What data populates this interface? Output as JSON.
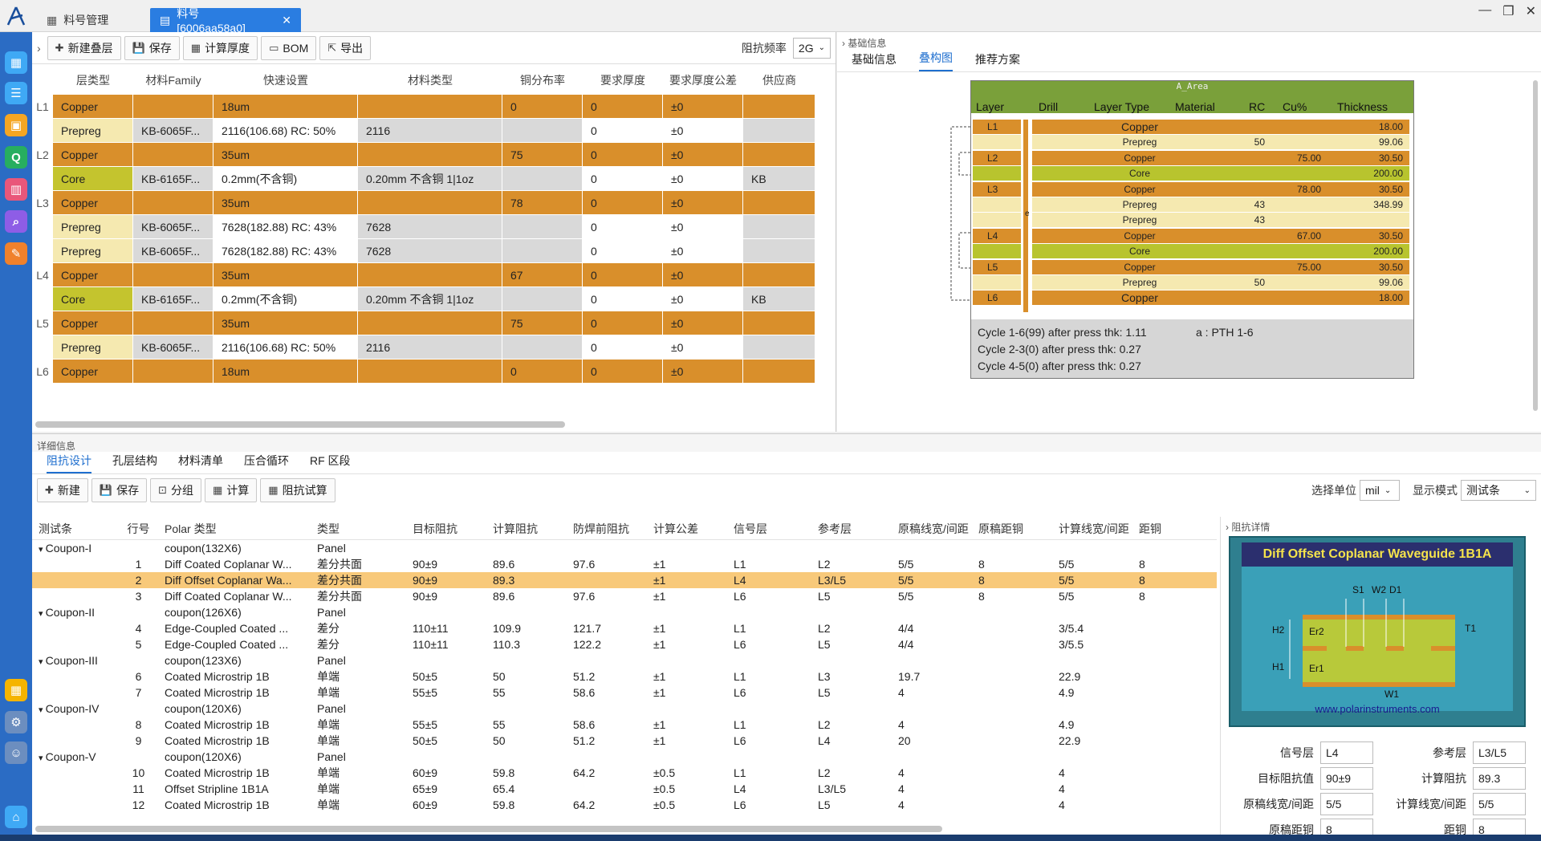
{
  "tabs": [
    {
      "label": "料号管理"
    },
    {
      "label": "料号[6006aa58a0]"
    }
  ],
  "toolbar": {
    "new_stack": "新建叠层",
    "save": "保存",
    "calc_thickness": "计算厚度",
    "bom": "BOM",
    "export": "导出",
    "freq_label": "阻抗频率",
    "freq_value": "2G"
  },
  "stack_headers": [
    "层类型",
    "材料Family",
    "快速设置",
    "材料类型",
    "铜分布率",
    "要求厚度",
    "要求厚度公差",
    "供应商"
  ],
  "stack_rows": [
    {
      "layer": "L1",
      "kind": "copper",
      "cells": [
        "Copper",
        "",
        "18um",
        "",
        "0",
        "0",
        "±0",
        ""
      ]
    },
    {
      "layer": "",
      "kind": "prepreg",
      "cells": [
        "Prepreg",
        "KB-6065F...",
        "2116(106.68) RC: 50%",
        "2116",
        "",
        "0",
        "±0",
        ""
      ]
    },
    {
      "layer": "L2",
      "kind": "copper",
      "cells": [
        "Copper",
        "",
        "35um",
        "",
        "75",
        "0",
        "±0",
        ""
      ]
    },
    {
      "layer": "",
      "kind": "core",
      "cells": [
        "Core",
        "KB-6165F...",
        "0.2mm(不含铜)",
        "0.20mm 不含铜 1|1oz",
        "",
        "0",
        "±0",
        "KB"
      ]
    },
    {
      "layer": "L3",
      "kind": "copper",
      "cells": [
        "Copper",
        "",
        "35um",
        "",
        "78",
        "0",
        "±0",
        ""
      ]
    },
    {
      "layer": "",
      "kind": "prepreg",
      "cells": [
        "Prepreg",
        "KB-6065F...",
        "7628(182.88) RC: 43%",
        "7628",
        "",
        "0",
        "±0",
        ""
      ]
    },
    {
      "layer": "",
      "kind": "prepreg",
      "cells": [
        "Prepreg",
        "KB-6065F...",
        "7628(182.88) RC: 43%",
        "7628",
        "",
        "0",
        "±0",
        ""
      ]
    },
    {
      "layer": "L4",
      "kind": "copper",
      "cells": [
        "Copper",
        "",
        "35um",
        "",
        "67",
        "0",
        "±0",
        ""
      ]
    },
    {
      "layer": "",
      "kind": "core",
      "cells": [
        "Core",
        "KB-6165F...",
        "0.2mm(不含铜)",
        "0.20mm 不含铜 1|1oz",
        "",
        "0",
        "±0",
        "KB"
      ]
    },
    {
      "layer": "L5",
      "kind": "copper",
      "cells": [
        "Copper",
        "",
        "35um",
        "",
        "75",
        "0",
        "±0",
        ""
      ]
    },
    {
      "layer": "",
      "kind": "prepreg",
      "cells": [
        "Prepreg",
        "KB-6065F...",
        "2116(106.68) RC: 50%",
        "2116",
        "",
        "0",
        "±0",
        ""
      ]
    },
    {
      "layer": "L6",
      "kind": "copper",
      "cells": [
        "Copper",
        "",
        "18um",
        "",
        "0",
        "0",
        "±0",
        ""
      ]
    }
  ],
  "right": {
    "section": "基础信息",
    "tabs": [
      "基础信息",
      "叠构图",
      "推荐方案"
    ],
    "active_tab": 1
  },
  "diagram": {
    "area": "A_Area",
    "headers": [
      "Layer",
      "Drill",
      "Layer Type",
      "Material",
      "RC",
      "Cu%",
      "Thickness"
    ],
    "rows": [
      {
        "layer": "L1",
        "type": "Copper",
        "rc": "",
        "cu": "",
        "th": "18.00",
        "kind": "copper"
      },
      {
        "layer": "",
        "type": "Prepreg",
        "rc": "50",
        "cu": "",
        "th": "99.06",
        "kind": "prepreg"
      },
      {
        "layer": "L2",
        "type": "Copper",
        "rc": "",
        "cu": "75.00",
        "th": "30.50",
        "kind": "copper"
      },
      {
        "layer": "",
        "type": "Core",
        "rc": "",
        "cu": "",
        "th": "200.00",
        "kind": "core"
      },
      {
        "layer": "L3",
        "type": "Copper",
        "rc": "",
        "cu": "78.00",
        "th": "30.50",
        "kind": "copper"
      },
      {
        "layer": "",
        "type": "Prepreg",
        "rc": "43",
        "cu": "",
        "th": "348.99",
        "kind": "prepreg"
      },
      {
        "layer": "",
        "type": "Prepreg",
        "rc": "43",
        "cu": "",
        "th": "",
        "kind": "prepreg"
      },
      {
        "layer": "L4",
        "type": "Copper",
        "rc": "",
        "cu": "67.00",
        "th": "30.50",
        "kind": "copper"
      },
      {
        "layer": "",
        "type": "Core",
        "rc": "",
        "cu": "",
        "th": "200.00",
        "kind": "core"
      },
      {
        "layer": "L5",
        "type": "Copper",
        "rc": "",
        "cu": "75.00",
        "th": "30.50",
        "kind": "copper"
      },
      {
        "layer": "",
        "type": "Prepreg",
        "rc": "50",
        "cu": "",
        "th": "99.06",
        "kind": "prepreg"
      },
      {
        "layer": "L6",
        "type": "Copper",
        "rc": "",
        "cu": "",
        "th": "18.00",
        "kind": "copper"
      }
    ],
    "drill_tag": "e",
    "notes": [
      "Cycle 1-6(99) after press thk: 1.11",
      "Cycle 2-3(0) after press thk: 0.27",
      "Cycle 4-5(0) after press thk: 0.27"
    ],
    "pth": "a : PTH 1-6"
  },
  "bottom": {
    "section": "详细信息",
    "tabs": [
      "阻抗设计",
      "孔层结构",
      "材料清单",
      "压合循环",
      "RF 区段"
    ],
    "tools": {
      "new": "新建",
      "save": "保存",
      "group": "分组",
      "calc": "计算",
      "trial": "阻抗试算"
    },
    "unit_label": "选择单位",
    "unit_value": "mil",
    "mode_label": "显示模式",
    "mode_value": "测试条"
  },
  "imp_headers": [
    "测试条",
    "行号",
    "Polar 类型",
    "类型",
    "目标阻抗",
    "计算阻抗",
    "防焊前阻抗",
    "计算公差",
    "信号层",
    "参考层",
    "原稿线宽/间距",
    "原稿距铜",
    "计算线宽/间距",
    "距铜"
  ],
  "imp_rows": [
    {
      "g": true,
      "c": [
        "Coupon-I",
        "",
        "coupon(132X6)",
        "Panel",
        "",
        "",
        "",
        "",
        "",
        "",
        "",
        "",
        "",
        ""
      ]
    },
    {
      "c": [
        "",
        "1",
        "Diff Coated Coplanar W...",
        "差分共面",
        "90±9",
        "89.6",
        "97.6",
        "±1",
        "L1",
        "L2",
        "5/5",
        "8",
        "5/5",
        "8"
      ]
    },
    {
      "sel": true,
      "c": [
        "",
        "2",
        "Diff Offset Coplanar Wa...",
        "差分共面",
        "90±9",
        "89.3",
        "",
        "±1",
        "L4",
        "L3/L5",
        "5/5",
        "8",
        "5/5",
        "8"
      ]
    },
    {
      "c": [
        "",
        "3",
        "Diff Coated Coplanar W...",
        "差分共面",
        "90±9",
        "89.6",
        "97.6",
        "±1",
        "L6",
        "L5",
        "5/5",
        "8",
        "5/5",
        "8"
      ]
    },
    {
      "g": true,
      "c": [
        "Coupon-II",
        "",
        "coupon(126X6)",
        "Panel",
        "",
        "",
        "",
        "",
        "",
        "",
        "",
        "",
        "",
        ""
      ]
    },
    {
      "c": [
        "",
        "4",
        "Edge-Coupled Coated ...",
        "差分",
        "110±11",
        "109.9",
        "121.7",
        "±1",
        "L1",
        "L2",
        "4/4",
        "",
        "3/5.4",
        ""
      ]
    },
    {
      "c": [
        "",
        "5",
        "Edge-Coupled Coated ...",
        "差分",
        "110±11",
        "110.3",
        "122.2",
        "±1",
        "L6",
        "L5",
        "4/4",
        "",
        "3/5.5",
        ""
      ]
    },
    {
      "g": true,
      "c": [
        "Coupon-III",
        "",
        "coupon(123X6)",
        "Panel",
        "",
        "",
        "",
        "",
        "",
        "",
        "",
        "",
        "",
        ""
      ]
    },
    {
      "c": [
        "",
        "6",
        "Coated Microstrip 1B",
        "单端",
        "50±5",
        "50",
        "51.2",
        "±1",
        "L1",
        "L3",
        "19.7",
        "",
        "22.9",
        ""
      ]
    },
    {
      "c": [
        "",
        "7",
        "Coated Microstrip 1B",
        "单端",
        "55±5",
        "55",
        "58.6",
        "±1",
        "L6",
        "L5",
        "4",
        "",
        "4.9",
        ""
      ]
    },
    {
      "g": true,
      "c": [
        "Coupon-IV",
        "",
        "coupon(120X6)",
        "Panel",
        "",
        "",
        "",
        "",
        "",
        "",
        "",
        "",
        "",
        ""
      ]
    },
    {
      "c": [
        "",
        "8",
        "Coated Microstrip 1B",
        "单端",
        "55±5",
        "55",
        "58.6",
        "±1",
        "L1",
        "L2",
        "4",
        "",
        "4.9",
        ""
      ]
    },
    {
      "c": [
        "",
        "9",
        "Coated Microstrip 1B",
        "单端",
        "50±5",
        "50",
        "51.2",
        "±1",
        "L6",
        "L4",
        "20",
        "",
        "22.9",
        ""
      ]
    },
    {
      "g": true,
      "c": [
        "Coupon-V",
        "",
        "coupon(120X6)",
        "Panel",
        "",
        "",
        "",
        "",
        "",
        "",
        "",
        "",
        "",
        ""
      ]
    },
    {
      "c": [
        "",
        "10",
        "Coated Microstrip 1B",
        "单端",
        "60±9",
        "59.8",
        "64.2",
        "±0.5",
        "L1",
        "L2",
        "4",
        "",
        "4",
        ""
      ]
    },
    {
      "c": [
        "",
        "11",
        "Offset Stripline 1B1A",
        "单端",
        "65±9",
        "65.4",
        "",
        "±0.5",
        "L4",
        "L3/L5",
        "4",
        "",
        "4",
        ""
      ]
    },
    {
      "c": [
        "",
        "12",
        "Coated Microstrip 1B",
        "单端",
        "60±9",
        "59.8",
        "64.2",
        "±0.5",
        "L6",
        "L5",
        "4",
        "",
        "4",
        ""
      ]
    }
  ],
  "details": {
    "title": "阻抗详情",
    "polar_title": "Diff Offset Coplanar Waveguide 1B1A",
    "polar_url": "www.polarinstruments.com",
    "labels": {
      "s1": "S1",
      "w2": "W2",
      "d1": "D1",
      "h2": "H2",
      "h1": "H1",
      "er2": "Er2",
      "er1": "Er1",
      "t1": "T1",
      "w1": "W1"
    },
    "fields": {
      "signal_label": "信号层",
      "signal": "L4",
      "ref_label": "参考层",
      "ref": "L3/L5",
      "target_label": "目标阻抗值",
      "target": "90±9",
      "calc_label": "计算阻抗",
      "calc": "89.3",
      "orig_label": "原稿线宽/间距",
      "orig": "5/5",
      "calcw_label": "计算线宽/间距",
      "calcw": "5/5",
      "copper_label": "原稿距铜",
      "copper": "8",
      "dist_label": "距铜",
      "dist": "8"
    }
  },
  "colors": {
    "accent": "#2a7de1",
    "copper": "#d98f2b",
    "prepreg": "#f5e9b0",
    "core": "#c4c42e",
    "selected": "#f8c97a",
    "diagram_header": "#7aa03a"
  }
}
